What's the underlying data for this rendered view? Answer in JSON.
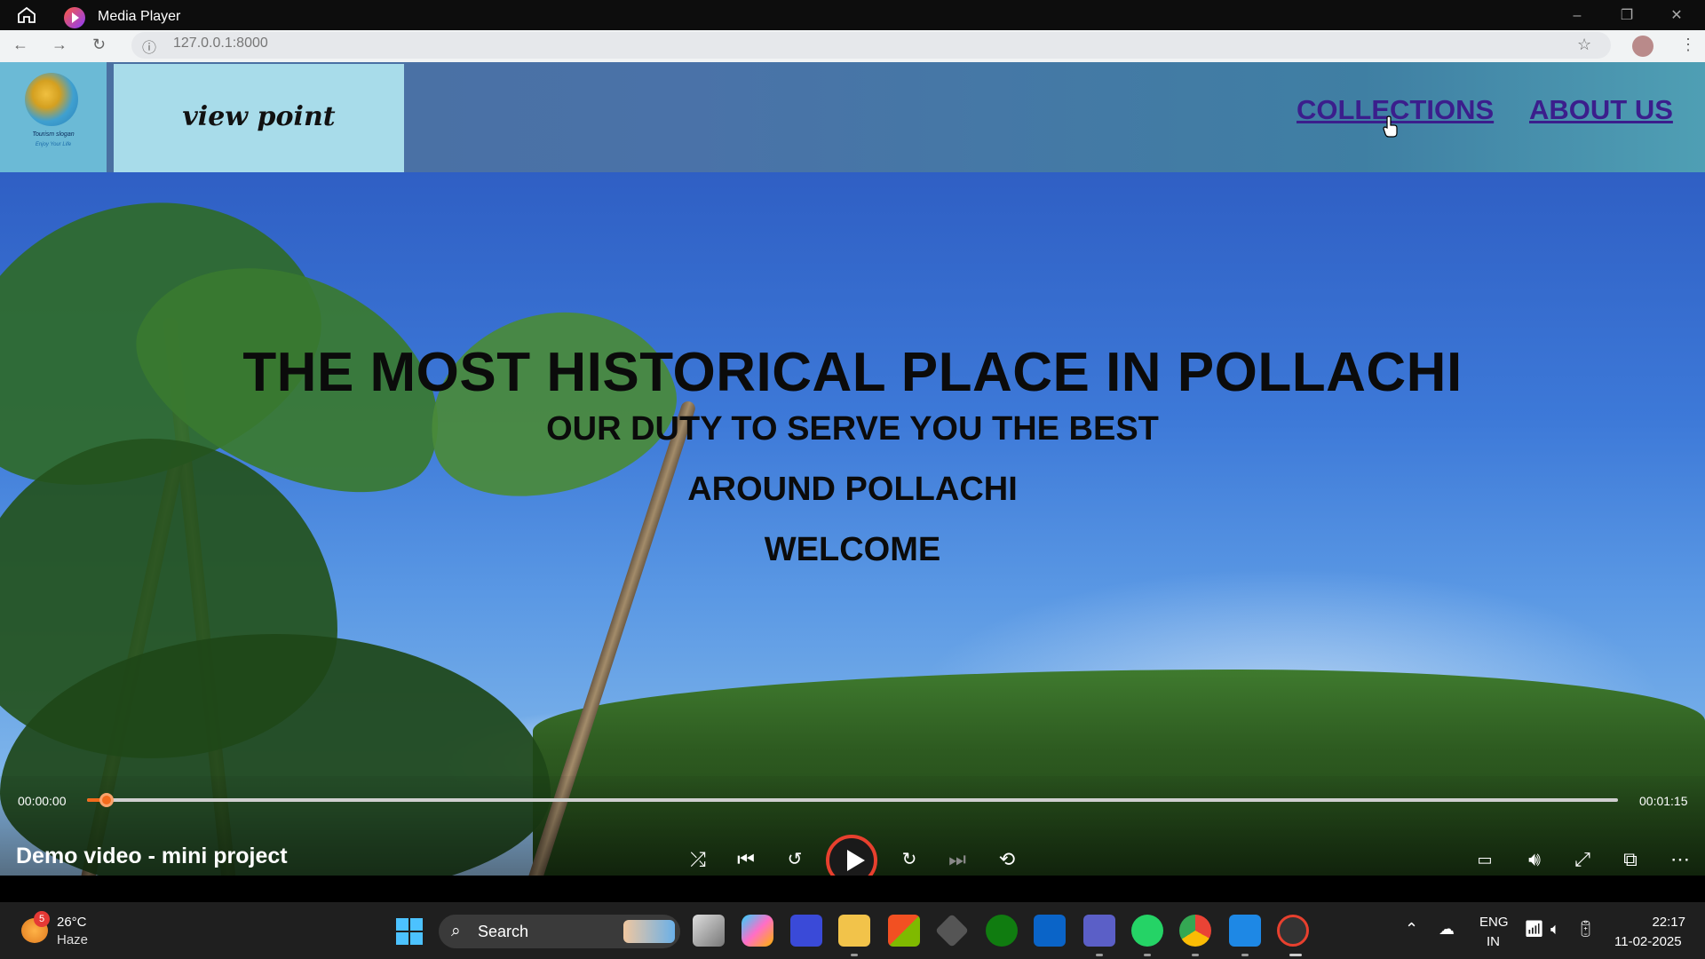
{
  "window": {
    "title": "Media Player",
    "controls": [
      "–",
      "❐",
      "✕"
    ]
  },
  "browser": {
    "url": "127.0.0.1:8000"
  },
  "site": {
    "logo_slogan": "Tourism slogan",
    "logo_tagline": "Enjoy Your Life",
    "brand": "view point",
    "nav": [
      {
        "label": "COLLECTIONS"
      },
      {
        "label": "ABOUT US"
      }
    ],
    "hero": {
      "headline": "THE MOST HISTORICAL PLACE IN POLLACHI",
      "line1": "OUR DUTY TO SERVE YOU THE BEST",
      "line2": "AROUND POLLACHI",
      "line3": "WELCOME"
    }
  },
  "player": {
    "current_time": "00:00:00",
    "total_time": "00:01:15",
    "progress_fraction": 0.0,
    "video_title": "Demo video - mini project",
    "accent_color": "#f26b1d",
    "buttons": [
      "shuffle-icon",
      "previous-icon",
      "rewind-10-icon",
      "play-icon",
      "forward-30-icon",
      "next-icon",
      "repeat-off-icon",
      "subtitles-icon",
      "volume-icon",
      "fullscreen-icon",
      "miniplayer-icon",
      "more-icon"
    ]
  },
  "taskbar": {
    "weather_badge": "5",
    "temperature": "26°C",
    "condition": "Haze",
    "search_label": "Search",
    "lang_top": "ENG",
    "lang_bottom": "IN",
    "time": "22:17",
    "date": "11-02-2025"
  }
}
